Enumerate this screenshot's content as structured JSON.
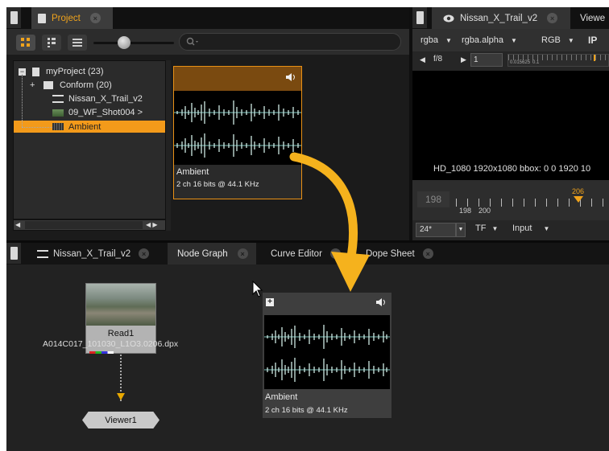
{
  "project_panel": {
    "tab_label": "Project",
    "search_placeholder": "",
    "tree": [
      {
        "label": "myProject (23)"
      },
      {
        "label": "Conform (20)"
      },
      {
        "label": "Nissan_X_Trail_v2"
      },
      {
        "label": "09_WF_Shot004 >"
      },
      {
        "label": "Ambient"
      }
    ],
    "clip": {
      "name": "Ambient",
      "info": "2 ch 16 bits @ 44.1 KHz"
    }
  },
  "viewer_panel": {
    "tab_label": "Nissan_X_Trail_v2",
    "tab2_label": "Viewe",
    "channels": "rgba",
    "alpha": "rgba.alpha",
    "colorspace": "RGB",
    "ip": "IP",
    "fstop": "f/8",
    "frame": "1",
    "ruler_values": [
      "0.015625",
      "0.1"
    ],
    "format_text": "HD_1080 1920x1080  bbox: 0 0 1920 10",
    "timeline": {
      "current": "198",
      "start": "198",
      "mark": "200",
      "marker": "206"
    },
    "fps": "24*",
    "tf": "TF",
    "input": "Input"
  },
  "bottom_tabs": [
    {
      "label": "Nissan_X_Trail_v2"
    },
    {
      "label": "Node Graph"
    },
    {
      "label": "Curve Editor"
    },
    {
      "label": "Dope Sheet"
    }
  ],
  "node_graph": {
    "read_node": {
      "name": "Read1",
      "file": "A014C017_101030_L1O3.0206.dpx"
    },
    "viewer_node": {
      "name": "Viewer1"
    },
    "audio_node": {
      "name": "Ambient",
      "info": "2 ch 16 bits @ 44.1 KHz"
    }
  },
  "colors": {
    "accent_orange": "#f0a31c",
    "arrow_yellow": "#f5b21d",
    "selected_row": "#f39a1a"
  }
}
